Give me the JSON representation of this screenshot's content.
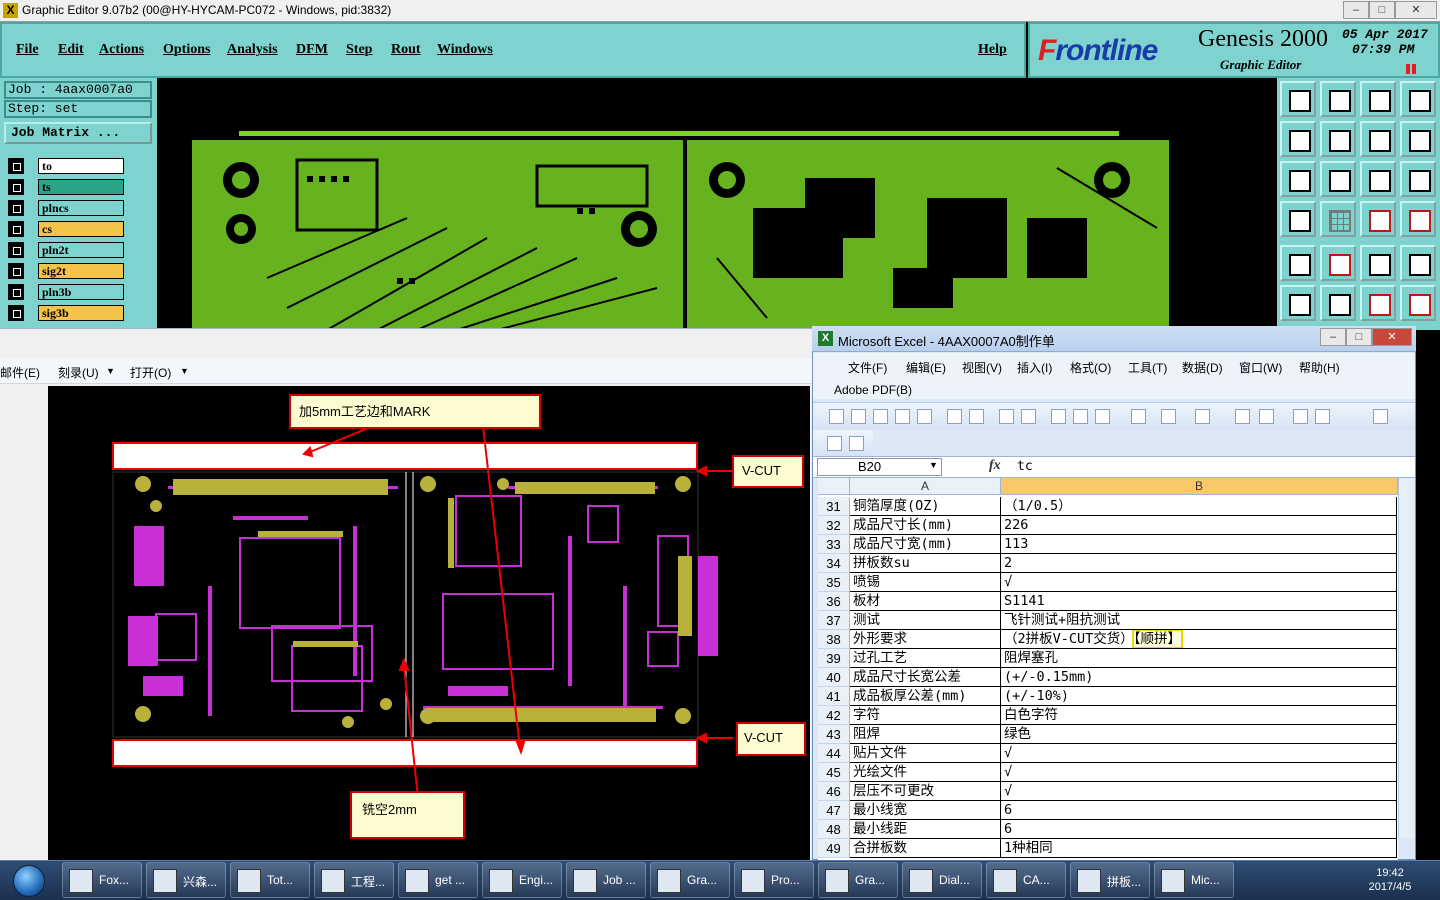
{
  "genesis": {
    "window_title": "Graphic Editor 9.07b2 (00@HY-HYCAM-PC072 - Windows, pid:3832)",
    "menu": [
      "File",
      "Edit",
      "Actions",
      "Options",
      "Analysis",
      "DFM",
      "Step",
      "Rout",
      "Windows"
    ],
    "help": "Help",
    "brand": {
      "logo_prefix": "F",
      "logo_rest": "rontline",
      "product": "Genesis 2000",
      "subtitle": "Graphic Editor",
      "date": "05 Apr 2017",
      "time": "07:39 PM"
    },
    "job_label": "Job : 4aax0007a0",
    "step_label": "Step: set",
    "job_matrix_button": "Job Matrix ...",
    "layers": [
      {
        "name": "to",
        "bg": "#ffffff"
      },
      {
        "name": "ts",
        "bg": "#2aa58a"
      },
      {
        "name": "plncs",
        "bg": "#7fd3cf"
      },
      {
        "name": "cs",
        "bg": "#f5c24a"
      },
      {
        "name": "pln2t",
        "bg": "#7fd3cf"
      },
      {
        "name": "sig2t",
        "bg": "#f5c24a"
      },
      {
        "name": "pln3b",
        "bg": "#7fd3cf"
      },
      {
        "name": "sig3b",
        "bg": "#f5c24a"
      }
    ]
  },
  "viewer": {
    "toolbar": [
      "邮件(E)",
      "刻录(U)",
      "打开(O)"
    ],
    "notes": {
      "top": "加5mm工艺边和MARK",
      "vcut_top": "V-CUT",
      "vcut_bottom": "V-CUT",
      "gap": "铣空2mm"
    }
  },
  "excel": {
    "title": "Microsoft Excel - 4AAX0007A0制作单",
    "menu": [
      "文件(F)",
      "编辑(E)",
      "视图(V)",
      "插入(I)",
      "格式(O)",
      "工具(T)",
      "数据(D)",
      "窗口(W)",
      "帮助(H)"
    ],
    "menu2": "Adobe PDF(B)",
    "name_box": "B20",
    "fx": "fx",
    "formula": "tc",
    "columns": [
      "A",
      "B"
    ],
    "rows": [
      {
        "n": "31",
        "a": "铜箔厚度(OZ)",
        "b": "（1/0.5）"
      },
      {
        "n": "32",
        "a": "成品尺寸长(mm)",
        "b": "226"
      },
      {
        "n": "33",
        "a": "成品尺寸宽(mm)",
        "b": "113"
      },
      {
        "n": "34",
        "a": "拼板数su",
        "b": "2"
      },
      {
        "n": "35",
        "a": "喷锡",
        "b": "√"
      },
      {
        "n": "36",
        "a": "板材",
        "b": "S1141"
      },
      {
        "n": "37",
        "a": "测试",
        "b": "飞针测试+阻抗测试"
      },
      {
        "n": "38",
        "a": "外形要求",
        "b": "（2拼板V-CUT交货）",
        "b_hl": "【顺拼】"
      },
      {
        "n": "39",
        "a": "过孔工艺",
        "b": "阻焊塞孔"
      },
      {
        "n": "40",
        "a": "成品尺寸长宽公差",
        "b": "(+/-0.15mm)"
      },
      {
        "n": "41",
        "a": "成品板厚公差(mm)",
        "b": "(+/-10%)"
      },
      {
        "n": "42",
        "a": "字符",
        "b": "白色字符"
      },
      {
        "n": "43",
        "a": "阻焊",
        "b": "绿色"
      },
      {
        "n": "44",
        "a": "贴片文件",
        "b": "√"
      },
      {
        "n": "45",
        "a": "光绘文件",
        "b": "√"
      },
      {
        "n": "46",
        "a": "层压不可更改",
        "b": "√"
      },
      {
        "n": "47",
        "a": "最小线宽",
        "b": "6"
      },
      {
        "n": "48",
        "a": "最小线距",
        "b": "6"
      },
      {
        "n": "49",
        "a": "合拼板数",
        "b": "1种相同"
      }
    ]
  },
  "taskbar": {
    "items": [
      "Fox...",
      "兴森...",
      "Tot...",
      "工程...",
      "get ...",
      "Engi...",
      "Job ...",
      "Gra...",
      "Pro...",
      "Gra...",
      "Dial...",
      "CA...",
      "拼板...",
      "Mic..."
    ],
    "time": "19:42",
    "date": "2017/4/5"
  },
  "colors": {
    "pcb_green": "#66b31f",
    "silk_magenta": "#c82fd6",
    "genesis_panel": "#7fd3cf"
  }
}
